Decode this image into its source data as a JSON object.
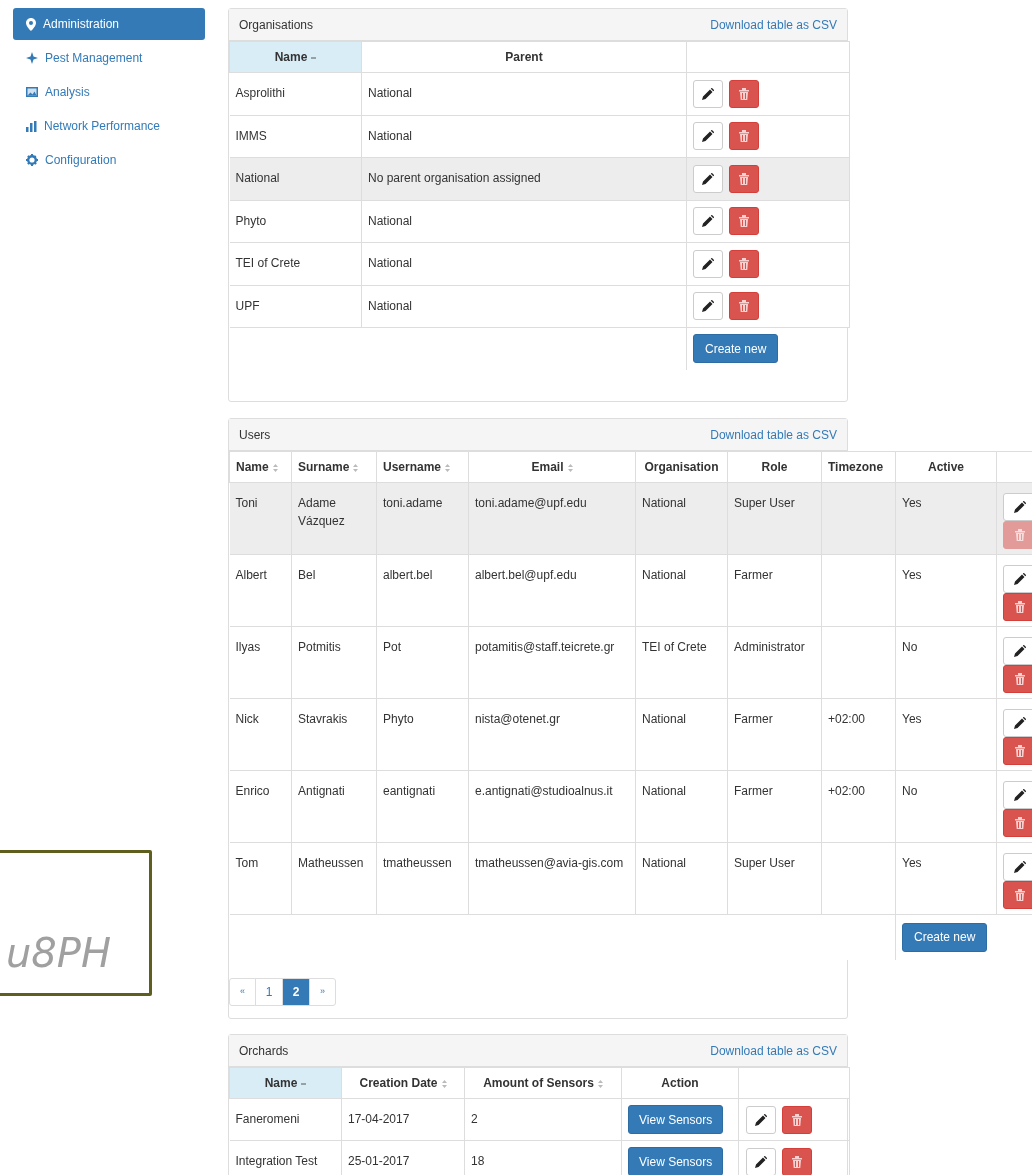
{
  "sidebar": {
    "items": [
      {
        "label": "Administration",
        "selected": true
      },
      {
        "label": "Pest Management",
        "selected": false
      },
      {
        "label": "Analysis",
        "selected": false
      },
      {
        "label": "Network Performance",
        "selected": false
      },
      {
        "label": "Configuration",
        "selected": false
      }
    ]
  },
  "captcha": {
    "text": "u8PH"
  },
  "organisations": {
    "title": "Organisations",
    "download": "Download table as CSV",
    "columns": [
      {
        "label": "Name",
        "sorted": true
      },
      {
        "label": "Parent",
        "sorted": false,
        "sortable": false
      }
    ],
    "rows": [
      {
        "name": "Asprolithi",
        "parent": "National",
        "highlighted": false
      },
      {
        "name": "IMMS",
        "parent": "National",
        "highlighted": false
      },
      {
        "name": "National",
        "parent": "No parent organisation assigned",
        "highlighted": true
      },
      {
        "name": "Phyto",
        "parent": "National",
        "highlighted": false
      },
      {
        "name": "TEI of Crete",
        "parent": "National",
        "highlighted": false
      },
      {
        "name": "UPF",
        "parent": "National",
        "highlighted": false
      }
    ],
    "create": "Create new"
  },
  "users": {
    "title": "Users",
    "download": "Download table as CSV",
    "columns": [
      {
        "label": "Name",
        "sorted": false,
        "sortable": true
      },
      {
        "label": "Surname",
        "sorted": false,
        "sortable": true
      },
      {
        "label": "Username",
        "sorted": false,
        "sortable": true
      },
      {
        "label": "Email",
        "sorted": false,
        "sortable": true
      },
      {
        "label": "Organisation",
        "sorted": false,
        "sortable": false
      },
      {
        "label": "Role",
        "sorted": false,
        "sortable": false
      },
      {
        "label": "Timezone",
        "sorted": false,
        "sortable": false
      },
      {
        "label": "Active",
        "sorted": false,
        "sortable": false
      }
    ],
    "rows": [
      {
        "cells": [
          "Toni",
          "Adame Vázquez",
          "toni.adame",
          "toni.adame@upf.edu",
          "National",
          "Super User",
          "",
          "Yes"
        ],
        "highlighted": true,
        "delete_disabled": true
      },
      {
        "cells": [
          "Albert",
          "Bel",
          "albert.bel",
          "albert.bel@upf.edu",
          "National",
          "Farmer",
          "",
          "Yes"
        ],
        "highlighted": false,
        "delete_disabled": false
      },
      {
        "cells": [
          "Ilyas",
          "Potmitis",
          "Pot",
          "potamitis@staff.teicrete.gr",
          "TEI of Crete",
          "Administrator",
          "",
          "No"
        ],
        "highlighted": false,
        "delete_disabled": false
      },
      {
        "cells": [
          "Nick",
          "Stavrakis",
          "Phyto",
          "nista@otenet.gr",
          "National",
          "Farmer",
          "+02:00",
          "Yes"
        ],
        "highlighted": false,
        "delete_disabled": false
      },
      {
        "cells": [
          "Enrico",
          "Antignati",
          "eantignati",
          "e.antignati@studioalnus.it",
          "National",
          "Farmer",
          "+02:00",
          "No"
        ],
        "highlighted": false,
        "delete_disabled": false
      },
      {
        "cells": [
          "Tom",
          "Matheussen",
          "tmatheussen",
          "tmatheussen@avia-gis.com",
          "National",
          "Super User",
          "",
          "Yes"
        ],
        "highlighted": false,
        "delete_disabled": false
      }
    ],
    "create": "Create new",
    "pagination": [
      {
        "label": "«",
        "selected": false
      },
      {
        "label": "1",
        "selected": false
      },
      {
        "label": "2",
        "selected": true
      },
      {
        "label": "»",
        "selected": false
      }
    ]
  },
  "orchards": {
    "title": "Orchards",
    "download": "Download table as CSV",
    "columns": [
      {
        "label": "Name",
        "sorted": true
      },
      {
        "label": "Creation Date",
        "sorted": false,
        "sortable": true
      },
      {
        "label": "Amount of Sensors",
        "sorted": false,
        "sortable": true
      },
      {
        "label": "Action",
        "sorted": false,
        "sortable": false
      }
    ],
    "rows": [
      {
        "name": "Faneromeni",
        "date": "17-04-2017",
        "sensors": "2",
        "action": "View Sensors"
      },
      {
        "name": "Integration Test",
        "date": "25-01-2017",
        "sensors": "18",
        "action": "View Sensors"
      }
    ]
  }
}
